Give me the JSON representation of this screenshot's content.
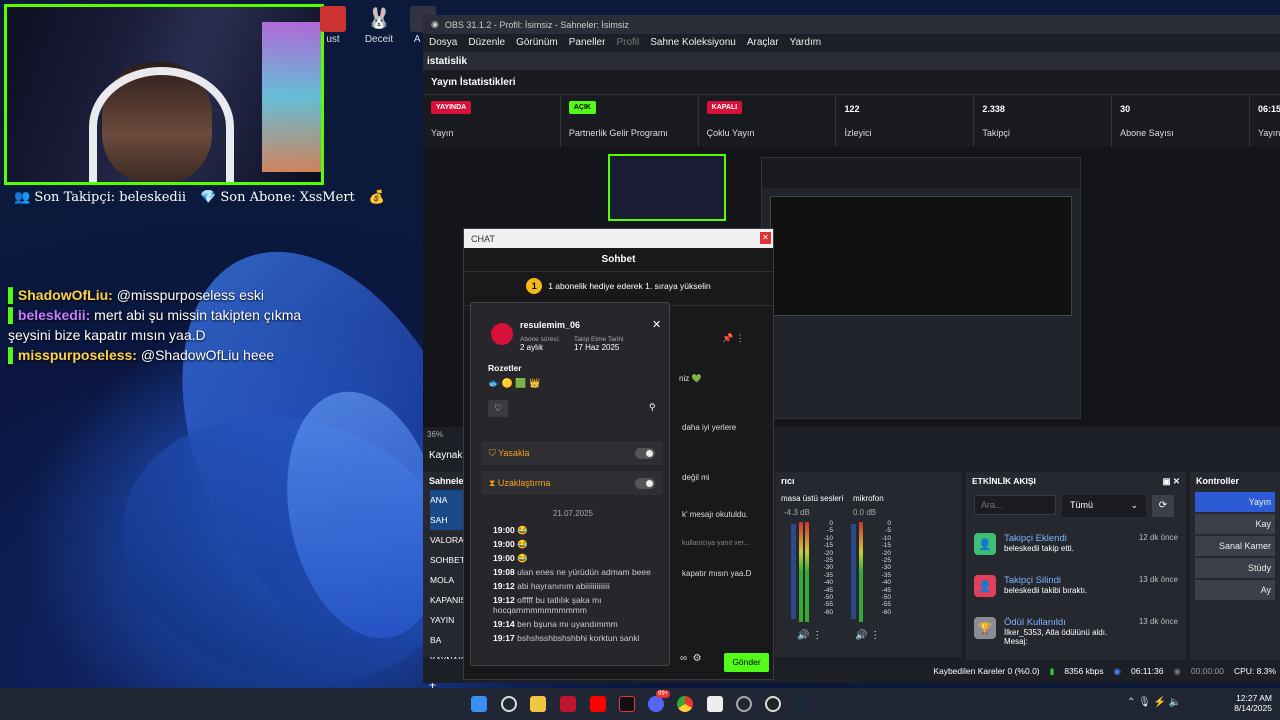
{
  "overlay": {
    "follower": "Son Takipçi: beleskedii",
    "sub": "Son Abone: XssMert",
    "chat": [
      {
        "user": "ShadowOfLiu:",
        "text": " @misspurposeless eski",
        "color": "#ffd24a"
      },
      {
        "user": "beleskedii:",
        "text": " mert abi şu missin takipten çıkma",
        "color": "#c77dff"
      },
      {
        "user": "",
        "text": "şeysini bize kapatır mısın yaa.D",
        "color": "#fff"
      },
      {
        "user": "misspurposeless:",
        "text": " @ShadowOfLiu heee",
        "color": "#ffd24a"
      }
    ]
  },
  "desktop": {
    "icons": [
      "ust",
      "Deceit",
      "A W"
    ]
  },
  "obs": {
    "title": "OBS 31.1.2 - Profil: İsimsiz - Sahneler: İsimsiz",
    "menu": [
      "Dosya",
      "Düzenle",
      "Görünüm",
      "Paneller",
      "Profil",
      "Sahne Koleksiyonu",
      "Araçlar",
      "Yardım"
    ],
    "stats_panel": "istatislik",
    "stats_header": "Yayın İstatistikleri",
    "stats": [
      {
        "badge": "YAYINDA",
        "label": "Yayın",
        "color": "#d8113a"
      },
      {
        "badge": "AÇIK",
        "label": "Partnerlik Gelir Programı",
        "color": "#53fc18"
      },
      {
        "badge": "KAPALI",
        "label": "Çoklu Yayın",
        "color": "#d8113a"
      },
      {
        "num": "122",
        "label": "İzleyici"
      },
      {
        "num": "2.338",
        "label": "Takipçi"
      },
      {
        "num": "30",
        "label": "Abone Sayısı"
      },
      {
        "num": "06:15",
        "label": "Yayın"
      }
    ],
    "zoom": "36%",
    "kaynak": "Kaynak s",
    "scenes_title": "Sahnele",
    "scenes": [
      "ANA SAH",
      "VALORA",
      "SOHBET",
      "MOLA",
      "KAPANIS",
      "YAYIN BA",
      "KAYNAK"
    ],
    "mixer_title": "rıcı",
    "mixer": [
      {
        "name": "masa üstü sesleri",
        "db": "-4.3 dB"
      },
      {
        "name": "mikrofon",
        "db": "0.0 dB"
      }
    ],
    "mixer_scale": [
      "0",
      "-5",
      "-10",
      "-15",
      "-20",
      "-25",
      "-30",
      "-35",
      "-40",
      "-45",
      "-50",
      "-55",
      "-60"
    ],
    "feed": {
      "title": "ETKİNLİK AKIŞI",
      "search_placeholder": "Ara...",
      "filter": "Tümü",
      "items": [
        {
          "title": "Takipçi Eklendi",
          "desc": "beleskedii takip etti.",
          "time": "12 dk önce",
          "color": "#3fbf74",
          "icon": "user-plus-icon"
        },
        {
          "title": "Takipçi Silindi",
          "desc": "beleskedii takibi bıraktı.",
          "time": "13 dk önce",
          "color": "#e0405a",
          "icon": "user-minus-icon"
        },
        {
          "title": "Ödül Kullanıldı",
          "desc": "İlker_5353, Atla ödülünü aldı.",
          "desc2": "Mesaj:",
          "time": "13 dk önce",
          "color": "#8a8d96",
          "icon": "trophy-icon"
        }
      ]
    },
    "controls": {
      "title": "Kontroller",
      "buttons": [
        "Yayın",
        "Kay",
        "Sanal Kamer",
        "Stüdy",
        "Ay"
      ]
    },
    "status": {
      "dropped": "Kaybedilen Kareler 0 (%0.0)",
      "bitrate": "8356 kbps",
      "live": "06:11:36",
      "rec": "00:00:00",
      "cpu": "CPU: 8.3%"
    }
  },
  "chat_popup": {
    "title": "CHAT",
    "header": "Sohbet",
    "pinned": "1 abonelik hediye ederek 1. sıraya yükselin",
    "bg_texts": [
      "niz 💚",
      "daha iyi yerlere",
      "değil mi",
      "k' mesajı okutuldu.",
      "kullanıcıya yanıt ver...",
      "kapatır mısın yaa.D"
    ],
    "send": "Gönder"
  },
  "usercard": {
    "username": "resulemim_06",
    "sub_label": "Abone süresi:",
    "sub_val": "2 aylık",
    "follow_label": "Takip Etme Tarihi",
    "follow_val": "17 Haz 2025",
    "badges_label": "Rozetler",
    "ban": "Yasakla",
    "timeout": "Uzaklaştırma",
    "date": "21.07.2025",
    "messages": [
      {
        "t": "19:00",
        "m": "😂"
      },
      {
        "t": "19:00",
        "m": "😂"
      },
      {
        "t": "19:00",
        "m": "😂"
      },
      {
        "t": "19:08",
        "m": "ulan enes ne yürüdün admam beee"
      },
      {
        "t": "19:12",
        "m": "abi hayranınım abiiiiiiiiiiiii"
      },
      {
        "t": "19:12",
        "m": "offfff bu tatlılık şaka mı hocqammmmmmmmmm"
      },
      {
        "t": "19:14",
        "m": "ben bşuna mı uyandımmm"
      },
      {
        "t": "19:17",
        "m": "bshshsshbshshbhi korktun sanki"
      }
    ]
  },
  "taskbar": {
    "time": "12:27 AM",
    "date": "8/14/2025",
    "badge": "99+"
  }
}
